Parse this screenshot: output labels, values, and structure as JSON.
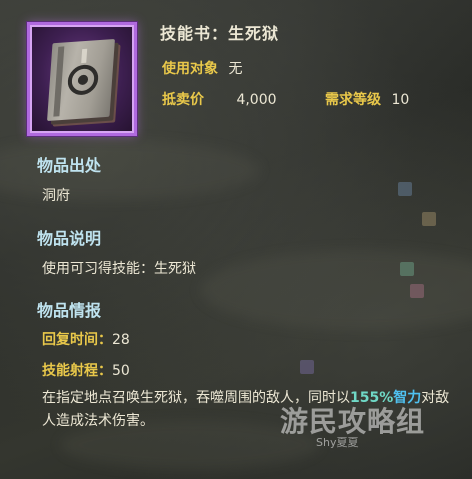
{
  "item": {
    "name": "技能书：生死狱",
    "use_target_label": "使用对象",
    "use_target_value": "无",
    "sell_price_label": "抵卖价",
    "sell_price_value": "4,000",
    "level_req_label": "需求等级",
    "level_req_value": "10",
    "frame_color": "#b06adf",
    "icon": "skill-book-icon"
  },
  "source": {
    "heading": "物品出处",
    "value": "洞府"
  },
  "description": {
    "heading": "物品说明",
    "text": "使用可习得技能：生死狱"
  },
  "info": {
    "heading": "物品情报",
    "recover_label": "回复时间：",
    "recover_value": "28",
    "range_label": "技能射程：",
    "range_value": "50",
    "desc_part1": "在指定地点召唤生死狱，吞噬周围的敌人，同时以",
    "desc_pct": "155%",
    "desc_attr": "智力",
    "desc_part2": "对敌人造成法术伤害。"
  },
  "watermark": {
    "logo": "游民攻略组",
    "sub": "Shy夏夏"
  },
  "colors": {
    "key_text": "#e9c84a",
    "section_heading": "#bfe3ef",
    "highlight_number": "#6fd8c6",
    "highlight_word": "#4fc0ef"
  }
}
